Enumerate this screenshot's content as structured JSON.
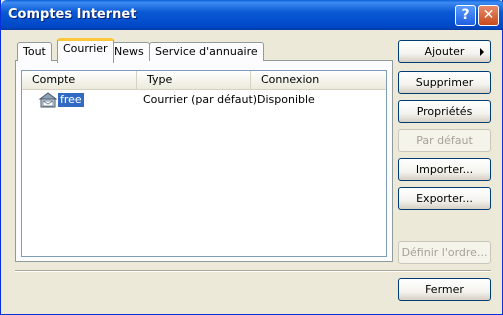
{
  "window": {
    "title": "Comptes Internet",
    "help_label": "?",
    "close_label": "✕"
  },
  "tabs": [
    {
      "label": "Tout"
    },
    {
      "label": "Courrier",
      "active": true
    },
    {
      "label": "News"
    },
    {
      "label": "Service d'annuaire"
    }
  ],
  "list": {
    "columns": [
      "Compte",
      "Type",
      "Connexion"
    ],
    "rows": [
      {
        "account": "free",
        "type": "Courrier (par défaut)",
        "connection": "Disponible",
        "icon": "mail-account-icon",
        "selected": true
      }
    ]
  },
  "buttons": {
    "add": "Ajouter",
    "remove": "Supprimer",
    "properties": "Propriétés",
    "default": "Par défaut",
    "import": "Importer...",
    "export": "Exporter...",
    "order": "Définir l'ordre...",
    "close": "Fermer"
  },
  "colors": {
    "titlebar": "#0054e3",
    "selection": "#316ac5",
    "tab_highlight": "#ffc83c"
  }
}
